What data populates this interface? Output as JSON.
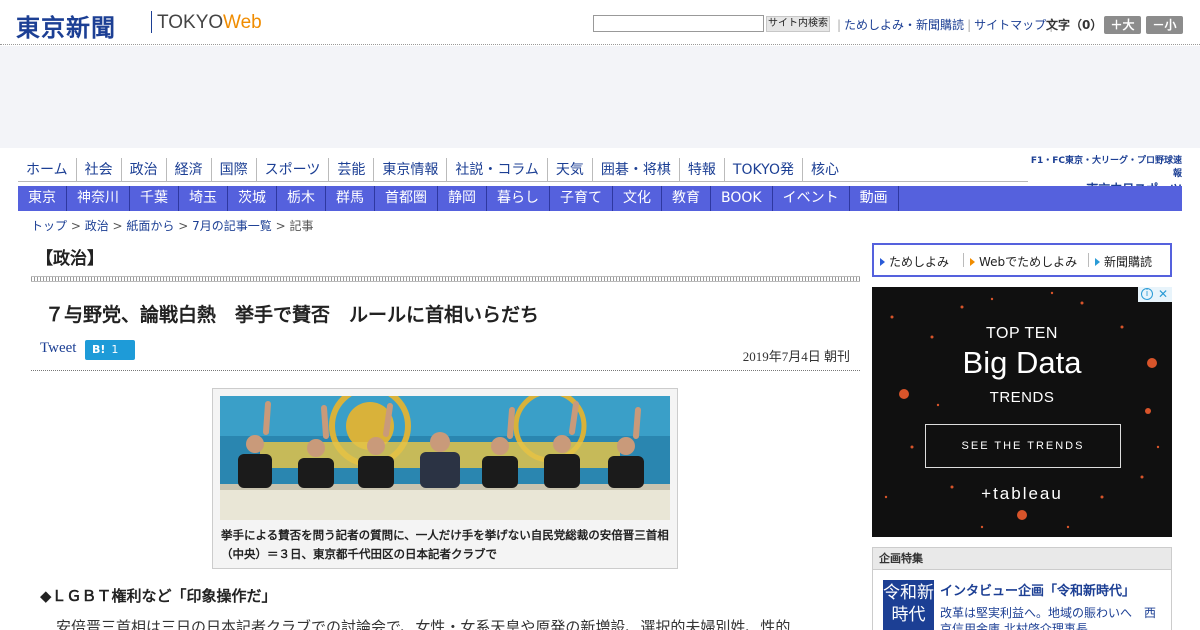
{
  "header": {
    "logo_jp": "東京新聞",
    "logo_tokyo": "TOKYO",
    "logo_web": "Web",
    "search_button": "サイト内検索",
    "links": [
      "ためしよみ・新聞購読",
      "サイトマップ"
    ],
    "font_size_label": "文字（0）",
    "larger_button": "＋大",
    "smaller_button": "－小"
  },
  "nav_primary": [
    "ホーム",
    "社会",
    "政治",
    "経済",
    "国際",
    "スポーツ",
    "芸能",
    "東京情報",
    "社説・コラム",
    "天気",
    "囲碁・将棋",
    "特報",
    "TOKYO発",
    "核心"
  ],
  "promo": {
    "line1": "F1・FC東京・大リーグ・プロ野球速報",
    "line2": "東京中日スポーツ"
  },
  "nav_secondary": [
    "東京",
    "神奈川",
    "千葉",
    "埼玉",
    "茨城",
    "栃木",
    "群馬",
    "首都圏",
    "静岡",
    "暮らし",
    "子育て",
    "文化",
    "教育",
    "BOOK",
    "イベント",
    "動画"
  ],
  "breadcrumb": [
    "トップ",
    "政治",
    "紙面から",
    "7月の記事一覧",
    "記事"
  ],
  "article": {
    "section": "【政治】",
    "headline": "７与野党、論戦白熱　挙手で賛否　ルールに首相いらだち",
    "tweet": "Tweet",
    "hatena_label": "B!",
    "hatena_count": "1",
    "date": "2019年7月4日 朝刊",
    "caption": "挙手による賛否を問う記者の質問に、一人だけ手を挙げない自民党総裁の安倍晋三首相（中央）＝３日、東京都千代田区の日本記者クラブで",
    "subhead": "◆ＬＧＢＴ権利など「印象操作だ」",
    "body": "安倍晋三首相は三日の日本記者クラブでの討論会で、女性・女系天皇や原発の新増設、選択的夫婦別姓、性的"
  },
  "sidebar": {
    "subscribe_links": [
      "ためしよみ",
      "Webでためしよみ",
      "新聞購読"
    ],
    "ad": {
      "line1": "TOP TEN",
      "line2": "Big Data",
      "line3": "TRENDS",
      "button": "SEE THE TRENDS",
      "brand": "+tableau"
    },
    "feature": {
      "header": "企画特集",
      "image_text": "令和新時代",
      "title": "インタビュー企画「令和新時代」",
      "desc": "改革は堅実利益へ。地域の賑わいへ　西京信用金庫 北村啓介理事長"
    }
  },
  "colors": {
    "brand_blue": "#1c3f94",
    "nav_bar": "#5561dd",
    "web_orange": "#f08c00",
    "hatena_blue": "#1e9bd8"
  }
}
